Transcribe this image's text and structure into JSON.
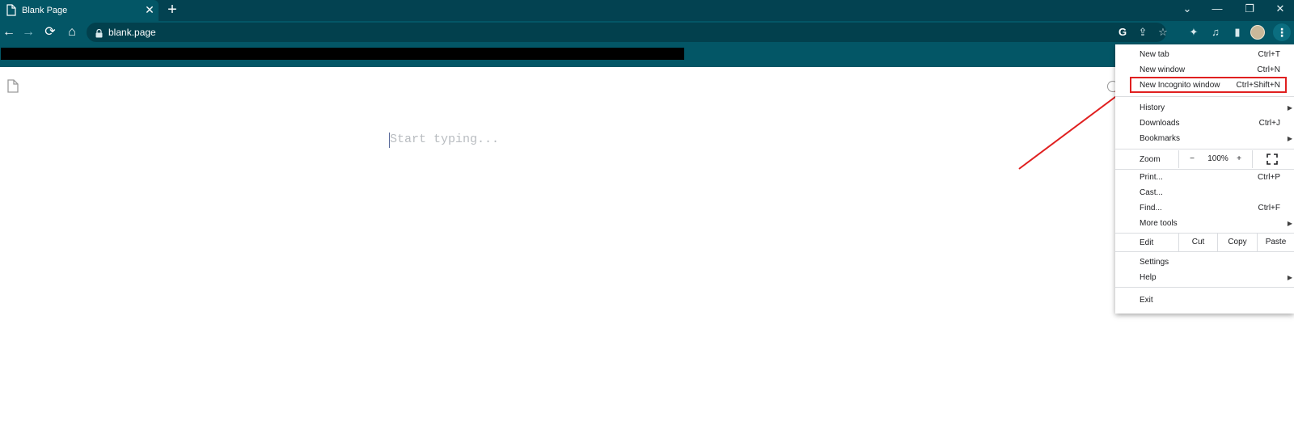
{
  "tab": {
    "title": "Blank Page",
    "close": "✕"
  },
  "new_tab": "+",
  "window_controls": {
    "tab_search": "⌄",
    "minimize": "—",
    "restore": "❐",
    "close": "✕"
  },
  "toolbar": {
    "back": "←",
    "forward": "→",
    "reload": "⟳",
    "home": "⌂",
    "url": "blank.page"
  },
  "omnibox_icons": {
    "google": "G",
    "share": "⇪",
    "bookmark": "☆"
  },
  "toolbar_icons": {
    "extensions": "✦",
    "media": "♫",
    "side_panel": "▮",
    "menu": "⋮"
  },
  "editor": {
    "placeholder": "Start typing..."
  },
  "menu": {
    "new_tab": {
      "label": "New tab",
      "shortcut": "Ctrl+T"
    },
    "new_window": {
      "label": "New window",
      "shortcut": "Ctrl+N"
    },
    "new_incognito": {
      "label": "New Incognito window",
      "shortcut": "Ctrl+Shift+N"
    },
    "history": {
      "label": "History"
    },
    "downloads": {
      "label": "Downloads",
      "shortcut": "Ctrl+J"
    },
    "bookmarks": {
      "label": "Bookmarks"
    },
    "zoom": {
      "label": "Zoom",
      "minus": "−",
      "value": "100%",
      "plus": "+"
    },
    "print": {
      "label": "Print...",
      "shortcut": "Ctrl+P"
    },
    "cast": {
      "label": "Cast..."
    },
    "find": {
      "label": "Find...",
      "shortcut": "Ctrl+F"
    },
    "more_tools": {
      "label": "More tools"
    },
    "edit": {
      "label": "Edit",
      "cut": "Cut",
      "copy": "Copy",
      "paste": "Paste"
    },
    "settings": {
      "label": "Settings"
    },
    "help": {
      "label": "Help"
    },
    "exit": {
      "label": "Exit"
    },
    "submenu_arrow": "▶"
  },
  "colors": {
    "tabstrip": "#034251",
    "toolbar": "#035666",
    "highlight": "#e02020",
    "arrow": "#e02020"
  }
}
